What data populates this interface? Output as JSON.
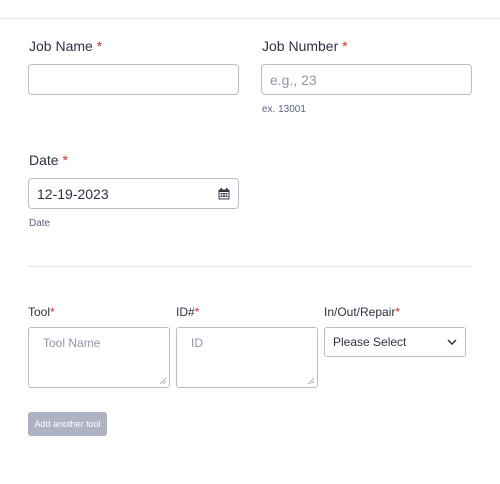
{
  "form": {
    "job_name": {
      "label": "Job Name",
      "required_mark": "*",
      "value": ""
    },
    "job_number": {
      "label": "Job Number",
      "required_mark": "*",
      "placeholder": "e.g., 23",
      "sublabel": "ex. 13001"
    },
    "date": {
      "label": "Date",
      "required_mark": "*",
      "value": "12-19-2023",
      "sublabel": "Date"
    },
    "tools": {
      "tool": {
        "label": "Tool",
        "required_mark": "*",
        "placeholder": "Tool Name"
      },
      "id": {
        "label": "ID#",
        "required_mark": "*",
        "placeholder": "ID"
      },
      "status": {
        "label": "In/Out/Repair",
        "required_mark": "*",
        "selected": "Please Select"
      }
    },
    "add_tool_button": "Add another tool"
  }
}
